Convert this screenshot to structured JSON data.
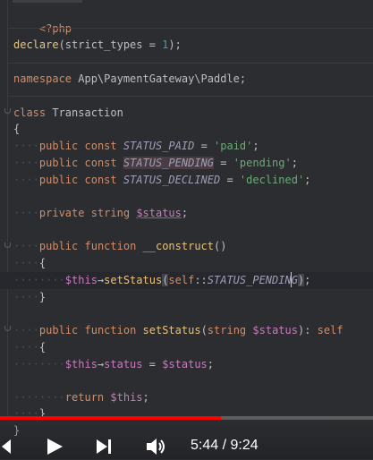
{
  "code": {
    "php_open": "<?php",
    "declare_kw": "declare",
    "declare_rest_1": "(strict_types = ",
    "declare_num": "1",
    "declare_rest_2": ");",
    "namespace_kw": "namespace",
    "namespace_path": " App\\PaymentGateway\\Paddle;",
    "class_kw": "class",
    "class_name": " Transaction",
    "brace_open": "{",
    "brace_close": "}",
    "dots4": "····",
    "dots8": "········",
    "kw_public": "public",
    "kw_const": "const",
    "kw_private": "private",
    "kw_string": "string",
    "kw_function": "function",
    "kw_return": "return",
    "kw_self": "self",
    "c_paid": "STATUS_PAID",
    "c_pending": "STATUS_PENDING",
    "c_declined": "STATUS_DECLINED",
    "s_paid": "'paid'",
    "s_pending": "'pending'",
    "s_declined": "'declined'",
    "eq": " = ",
    "semi": ";",
    "var_status": "$status",
    "fn_construct": "__construct",
    "parens": "()",
    "this": "$this",
    "arrow": "→",
    "fn_setStatus": "setStatus",
    "paren_open": "(",
    "paren_close": ")",
    "colons": "::",
    "prop_status": "status",
    "ret_sep": "): ",
    "bracket_fade": "}"
  },
  "player": {
    "progress_fraction": 0.5917,
    "current_time": "5:44",
    "separator": " / ",
    "total_time": "9:24",
    "icons": [
      "skip-back-icon",
      "play-icon",
      "skip-next-icon",
      "volume-icon"
    ]
  }
}
